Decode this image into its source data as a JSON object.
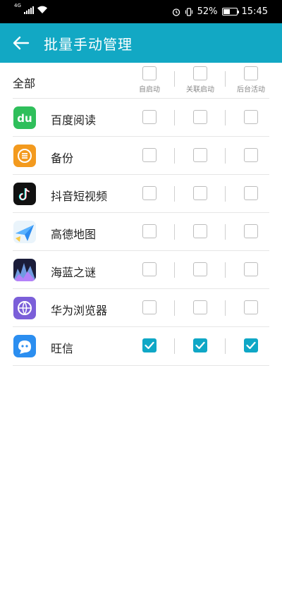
{
  "status_bar": {
    "network": "4G",
    "battery": "52%",
    "battery_level": 0.52,
    "time": "15:45"
  },
  "app_bar": {
    "title": "批量手动管理",
    "back_icon": "arrow-left-icon"
  },
  "header": {
    "all_label": "全部",
    "columns": [
      {
        "label": "自启动",
        "checked": false
      },
      {
        "label": "关联启动",
        "checked": false
      },
      {
        "label": "后台活动",
        "checked": false
      }
    ]
  },
  "apps": [
    {
      "name": "百度阅读",
      "icon": "baidu-read-icon",
      "color": "#2fbf5b",
      "auto": false,
      "assoc": false,
      "bg": false
    },
    {
      "name": "备份",
      "icon": "backup-icon",
      "color": "#f39a1e",
      "auto": false,
      "assoc": false,
      "bg": false
    },
    {
      "name": "抖音短视频",
      "icon": "douyin-icon",
      "color": "#111111",
      "auto": false,
      "assoc": false,
      "bg": false
    },
    {
      "name": "高德地图",
      "icon": "amap-icon",
      "color": "#2d8cf0",
      "auto": false,
      "assoc": false,
      "bg": false
    },
    {
      "name": "海蓝之谜",
      "icon": "game-icon",
      "color": "#3a3f6e",
      "auto": false,
      "assoc": false,
      "bg": false
    },
    {
      "name": "华为浏览器",
      "icon": "browser-icon",
      "color": "#7b5fd9",
      "auto": false,
      "assoc": false,
      "bg": false
    },
    {
      "name": "旺信",
      "icon": "wangxin-icon",
      "color": "#2b8ef0",
      "auto": true,
      "assoc": true,
      "bg": true
    }
  ],
  "colors": {
    "accent": "#12a8c4",
    "checkbox_checked": "#0fa7c6"
  }
}
